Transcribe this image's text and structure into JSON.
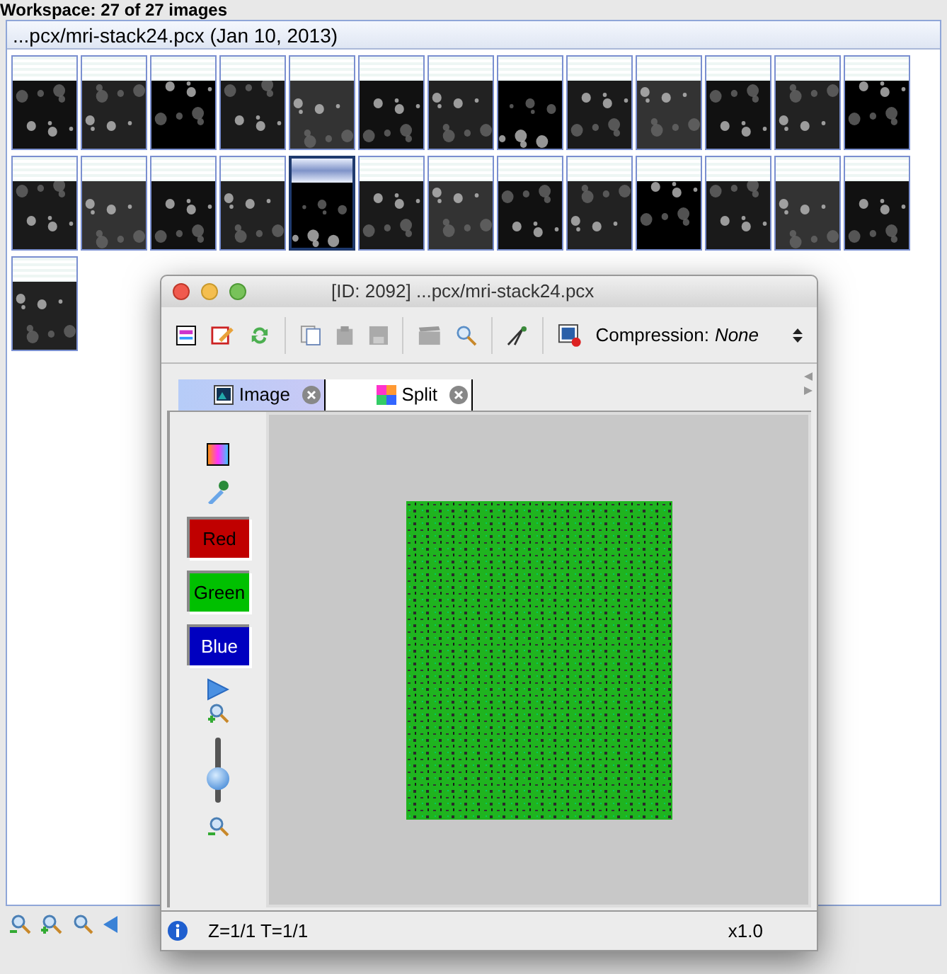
{
  "workspace": {
    "title": "Workspace: 27 of 27 images",
    "header": "...pcx/mri-stack24.pcx (Jan 10, 2013)",
    "thumbnails": [
      {
        "kind": "picture",
        "selected": false
      },
      {
        "kind": "picture",
        "selected": false
      },
      {
        "kind": "picture",
        "selected": false
      },
      {
        "kind": "picture",
        "selected": false
      },
      {
        "kind": "picture",
        "selected": false
      },
      {
        "kind": "picture",
        "selected": false
      },
      {
        "kind": "picture",
        "selected": false
      },
      {
        "kind": "picture",
        "selected": false
      },
      {
        "kind": "picture",
        "selected": false
      },
      {
        "kind": "picture",
        "selected": false
      },
      {
        "kind": "picture",
        "selected": false
      },
      {
        "kind": "picture",
        "selected": false
      },
      {
        "kind": "picture",
        "selected": false
      },
      {
        "kind": "picture",
        "selected": false
      },
      {
        "kind": "picture",
        "selected": false
      },
      {
        "kind": "picture",
        "selected": false
      },
      {
        "kind": "picture",
        "selected": false
      },
      {
        "kind": "picture",
        "selected": true
      },
      {
        "kind": "picture",
        "selected": false
      },
      {
        "kind": "picture",
        "selected": false
      },
      {
        "kind": "picture",
        "selected": false
      },
      {
        "kind": "picture",
        "selected": false
      },
      {
        "kind": "picture",
        "selected": false
      },
      {
        "kind": "picture",
        "selected": false
      },
      {
        "kind": "picture",
        "selected": false
      },
      {
        "kind": "picture",
        "selected": false
      },
      {
        "kind": "picture",
        "selected": false
      }
    ]
  },
  "viewer": {
    "title": "[ID: 2092] ...pcx/mri-stack24.pcx",
    "compression_label": "Compression:",
    "compression_value": "None",
    "tabs": [
      {
        "label": "Image",
        "selected": true
      },
      {
        "label": "Split",
        "selected": false
      }
    ],
    "channels": [
      {
        "label": "Red",
        "color": "#c00000"
      },
      {
        "label": "Green",
        "color": "#00c000"
      },
      {
        "label": "Blue",
        "color": "#0000c0"
      }
    ],
    "zoom_slider": {
      "level": 0.3
    },
    "status": "Z=1/1 T=1/1",
    "zoom": "x1.0"
  }
}
